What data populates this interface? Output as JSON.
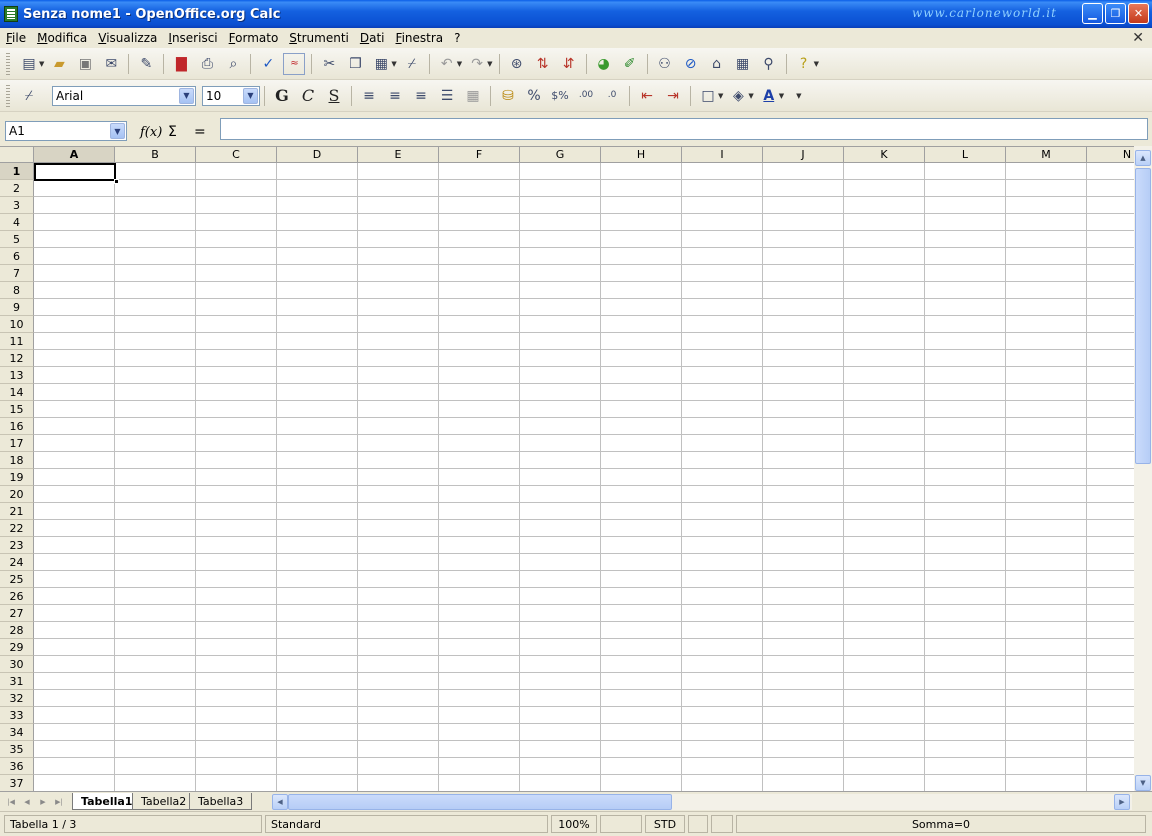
{
  "window": {
    "title": "Senza nome1 - OpenOffice.org Calc",
    "watermark": "www.carloneworld.it",
    "minimize_glyph": "▁",
    "maximize_glyph": "❐",
    "close_glyph": "✕",
    "doc_close_glyph": "✕"
  },
  "menu": [
    "File",
    "Modifica",
    "Visualizza",
    "Inserisci",
    "Formato",
    "Strumenti",
    "Dati",
    "Finestra",
    "?"
  ],
  "toolbar_standard": [
    "new-document-icon",
    "open-folder-icon",
    "save-icon",
    "email-icon",
    "edit-file-icon",
    "export-pdf-icon",
    "print-icon",
    "page-preview-icon",
    "spellcheck-icon",
    "autospellcheck-icon",
    "cut-icon",
    "copy-icon",
    "paste-icon",
    "format-paintbrush-icon",
    "undo-icon",
    "redo-icon",
    "hyperlink-icon",
    "sort-ascending-icon",
    "sort-descending-icon",
    "chart-icon",
    "draw-functions-icon",
    "find-replace-icon",
    "navigator-icon",
    "gallery-icon",
    "data-sources-icon",
    "zoom-icon",
    "help-icon"
  ],
  "toolbar_format": {
    "font_name": "Arial",
    "font_size": "10",
    "bold": "G",
    "italic": "C",
    "underline": "S",
    "icons": [
      "align-left-icon",
      "align-center-icon",
      "align-right-icon",
      "justify-icon",
      "merge-cells-icon",
      "currency-format-icon",
      "percent-format-icon",
      "standard-number-icon",
      "add-decimal-icon",
      "remove-decimal-icon",
      "decrease-indent-icon",
      "increase-indent-icon",
      "borders-icon",
      "background-color-icon",
      "font-color-icon"
    ]
  },
  "formula_bar": {
    "name_box": "A1",
    "function_wizard": "f(x)",
    "sum": "Σ",
    "equals": "=",
    "formula": ""
  },
  "grid": {
    "columns": [
      "A",
      "B",
      "C",
      "D",
      "E",
      "F",
      "G",
      "H",
      "I",
      "J",
      "K",
      "L",
      "M",
      "N"
    ],
    "rows": [
      "1",
      "2",
      "3",
      "4",
      "5",
      "6",
      "7",
      "8",
      "9",
      "10",
      "11",
      "12",
      "13",
      "14",
      "15",
      "16",
      "17",
      "18",
      "19",
      "20",
      "21",
      "22",
      "23",
      "24",
      "25",
      "26",
      "27",
      "28",
      "29",
      "30",
      "31",
      "32",
      "33",
      "34",
      "35",
      "36",
      "37"
    ],
    "selected_column": "A",
    "selected_row": "1",
    "active_cell": "A1"
  },
  "sheets": {
    "tabs": [
      "Tabella1",
      "Tabella2",
      "Tabella3"
    ],
    "active": "Tabella1"
  },
  "status_bar": {
    "sheet_position": "Tabella 1 / 3",
    "page_style": "Standard",
    "zoom": "100%",
    "selection_mode": "STD",
    "sum": "Somma=0"
  },
  "colors": {
    "titlebar": "#0a4fd1",
    "chrome": "#ece9d8",
    "grid_lines": "#c0c0c0"
  }
}
